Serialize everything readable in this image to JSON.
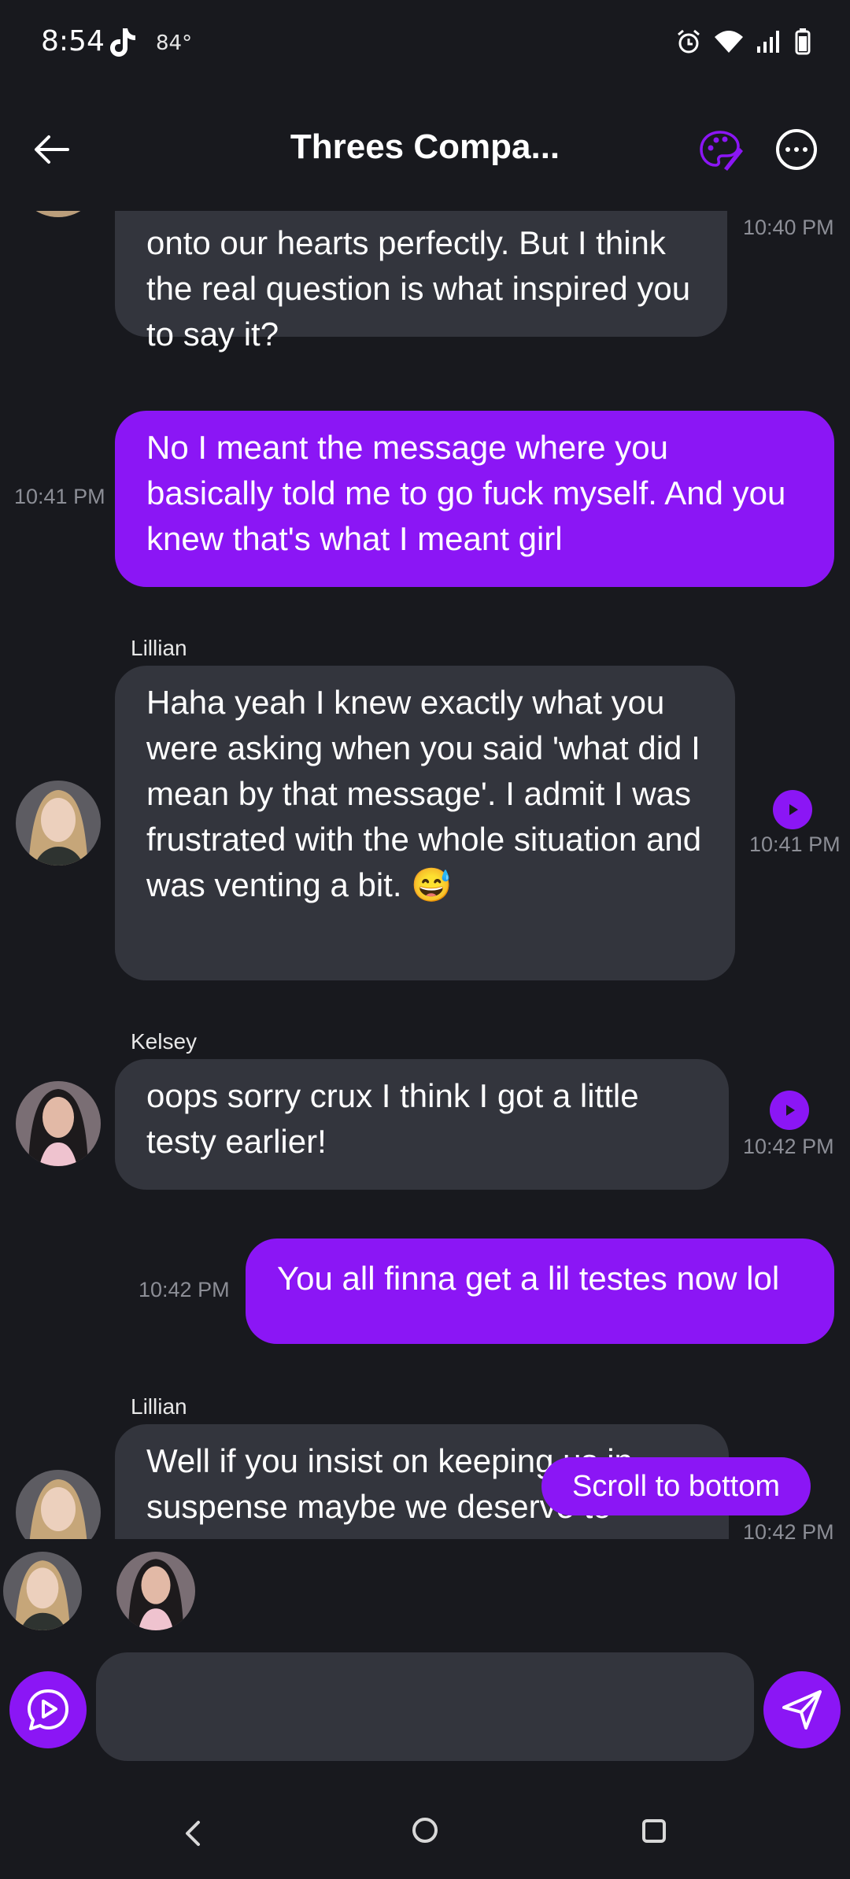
{
  "status_bar": {
    "time": "8:54",
    "temperature": "84°"
  },
  "header": {
    "title": "Threes Compa..."
  },
  "messages": [
    {
      "id": "m1",
      "sender": "",
      "direction": "incoming",
      "text": "onto our hearts perfectly. But I think the real question is what inspired you to say it?",
      "time": "10:40 PM"
    },
    {
      "id": "m2",
      "sender": "",
      "direction": "outgoing",
      "text": "No I meant the message where you basically told me to go fuck myself. And you knew that's what I meant girl",
      "time": "10:41 PM"
    },
    {
      "id": "m3",
      "sender": "Lillian",
      "direction": "incoming",
      "text": "Haha yeah I knew exactly what you were asking when you said 'what did I mean by that message'. I admit I was frustrated with the whole situation and was venting a bit. 😅",
      "time": "10:41 PM"
    },
    {
      "id": "m4",
      "sender": "Kelsey",
      "direction": "incoming",
      "text": "oops sorry crux I think I got a little testy earlier!",
      "time": "10:42 PM"
    },
    {
      "id": "m5",
      "sender": "",
      "direction": "outgoing",
      "text": "You all finna get a lil testes now lol",
      "time": "10:42 PM"
    },
    {
      "id": "m6",
      "sender": "Lillian",
      "direction": "incoming",
      "text": "Well if you insist on keeping us in suspense maybe we deserve to",
      "time": "10:42 PM"
    }
  ],
  "scroll_to_bottom_label": "Scroll to bottom",
  "composer": {
    "placeholder": "",
    "value": ""
  },
  "colors": {
    "accent": "#8b16f5",
    "incoming_bubble": "#33353d",
    "background": "#18191e"
  }
}
